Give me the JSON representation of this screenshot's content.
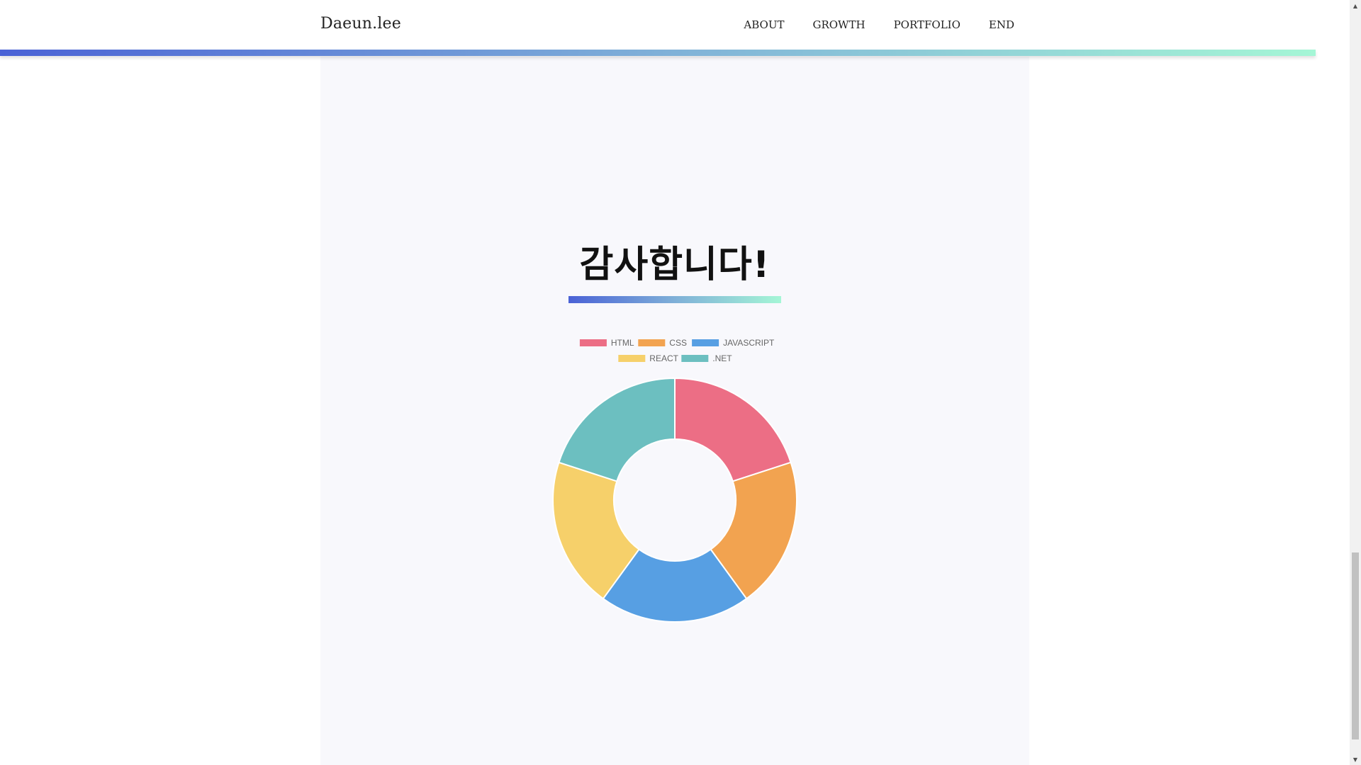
{
  "header": {
    "brand": "Daeun.lee",
    "nav": [
      {
        "label": "ABOUT"
      },
      {
        "label": "GROWTH"
      },
      {
        "label": "PORTFOLIO"
      },
      {
        "label": "END"
      }
    ],
    "progress_gradient": [
      "#4a62d6",
      "#a5f6d6"
    ],
    "scroll_progress": 1.0
  },
  "thanks": {
    "title": "감사합니다!"
  },
  "chart_data": {
    "type": "doughnut",
    "categories": [
      "HTML",
      "CSS",
      "JAVASCRIPT",
      "REACT",
      ".NET"
    ],
    "values": [
      20,
      20,
      20,
      20,
      20
    ],
    "colors": [
      "#ec6e85",
      "#f2a350",
      "#579fe3",
      "#f6d06a",
      "#6cbfc0"
    ],
    "legend_position": "top",
    "cutout": 0.5
  },
  "scrollbar": {
    "up_icon": "▲",
    "down_icon": "▼",
    "position": 0.97
  }
}
